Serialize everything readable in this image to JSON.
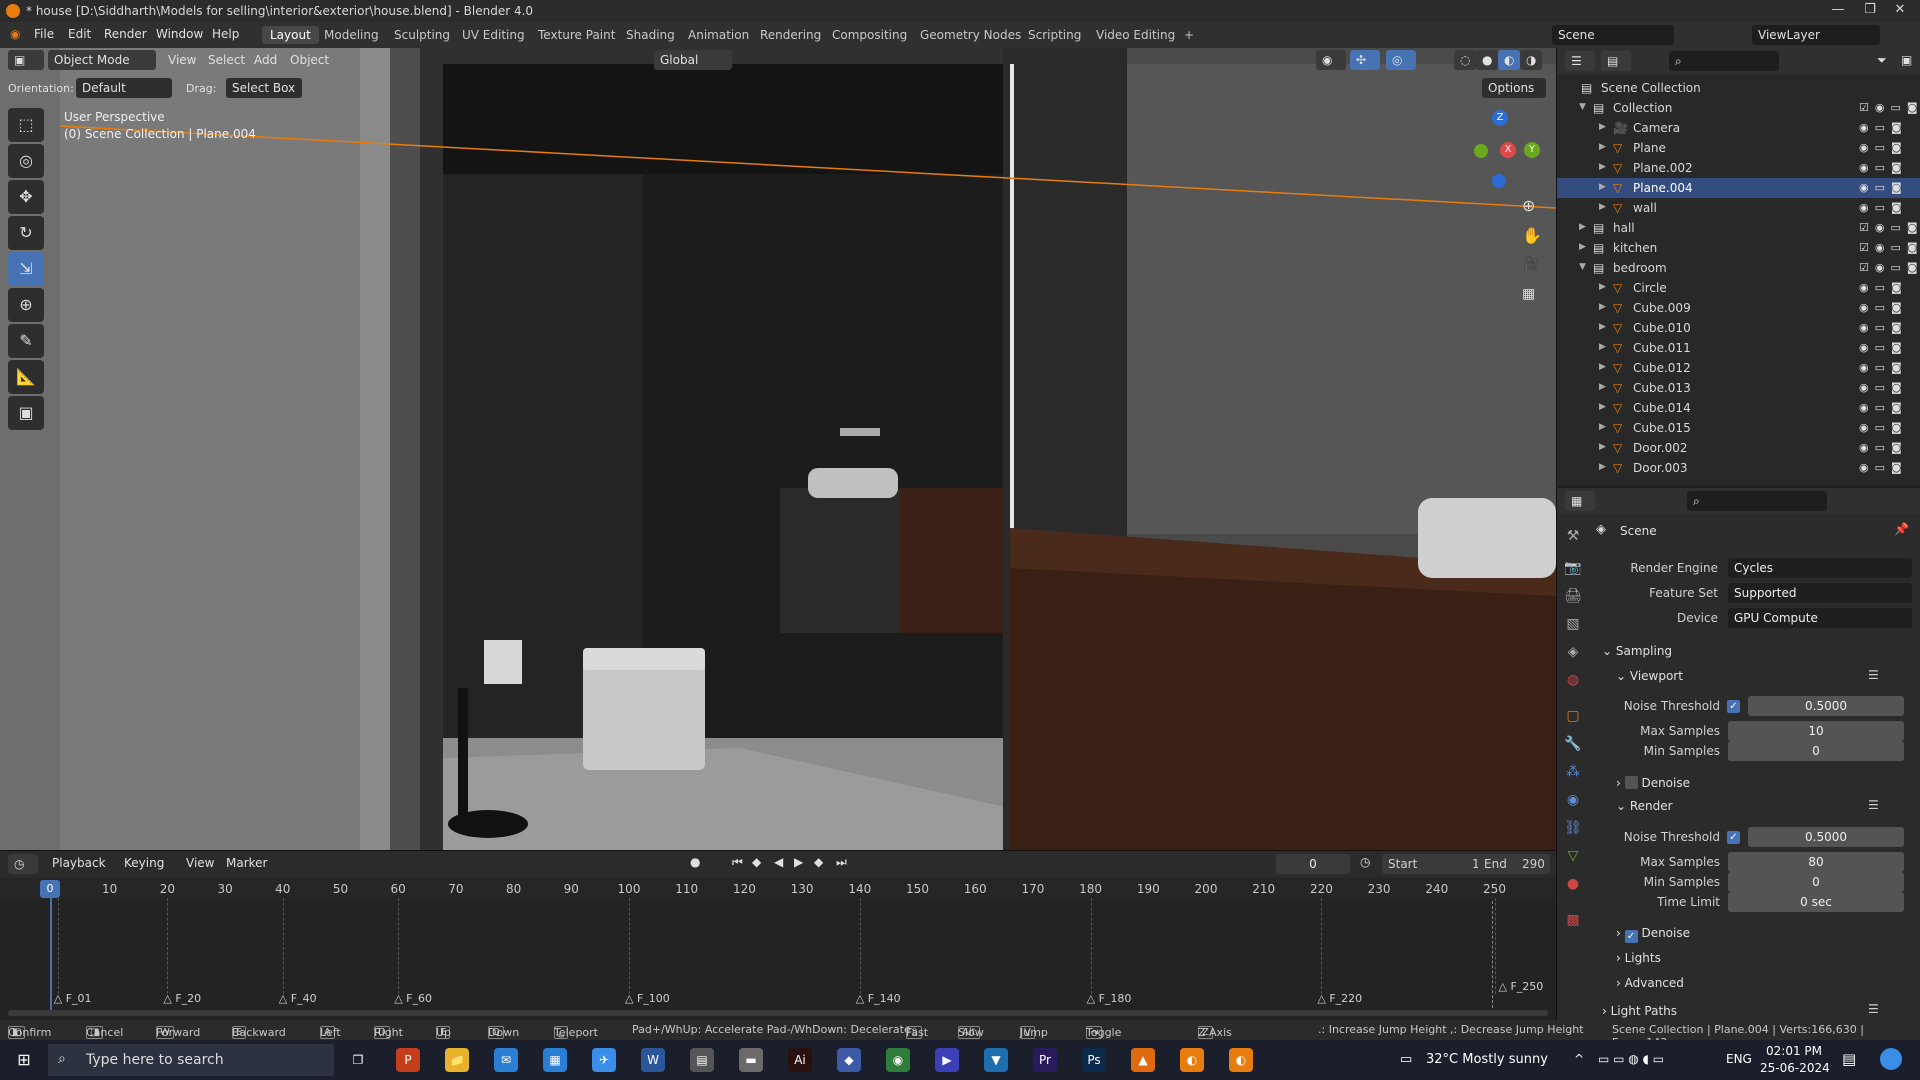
{
  "window": {
    "title": "* house [D:\\Siddharth\\Models for selling\\interior&exterior\\house.blend] - Blender 4.0",
    "minimize": "—",
    "maximize": "❐",
    "close": "✕"
  },
  "menu": [
    "File",
    "Edit",
    "Render",
    "Window",
    "Help"
  ],
  "workspaces": [
    "Layout",
    "Modeling",
    "Sculpting",
    "UV Editing",
    "Texture Paint",
    "Shading",
    "Animation",
    "Rendering",
    "Compositing",
    "Geometry Nodes",
    "Scripting",
    "Video Editing"
  ],
  "workspace_add": "+",
  "scene_field": "Scene",
  "viewlayer_field": "ViewLayer",
  "viewport_header": {
    "mode": "Object Mode",
    "menus": [
      "View",
      "Select",
      "Add",
      "Object"
    ],
    "transform": "Global",
    "options": "Options"
  },
  "tool_settings": {
    "orientation_label": "Orientation:",
    "orientation": "Default",
    "drag_label": "Drag:",
    "drag": "Select Box"
  },
  "viewport_info": {
    "perspective": "User Perspective",
    "collection": "(0) Scene Collection | Plane.004"
  },
  "gizmo": {
    "z": "Z",
    "x": "X",
    "y": "Y"
  },
  "tools": [
    "⬚",
    "◎",
    "✥",
    "↻",
    "⇲",
    "⊕",
    "✎",
    "📐",
    "▣"
  ],
  "outliner": {
    "root": "Scene Collection",
    "rows": [
      {
        "name": "Collection",
        "indent": 1,
        "type": "collection",
        "expanded": true
      },
      {
        "name": "Camera",
        "indent": 2,
        "type": "camera"
      },
      {
        "name": "Plane",
        "indent": 2,
        "type": "mesh"
      },
      {
        "name": "Plane.002",
        "indent": 2,
        "type": "mesh"
      },
      {
        "name": "Plane.004",
        "indent": 2,
        "type": "mesh",
        "selected": true
      },
      {
        "name": "wall",
        "indent": 2,
        "type": "mesh"
      },
      {
        "name": "hall",
        "indent": 1,
        "type": "collection"
      },
      {
        "name": "kitchen",
        "indent": 1,
        "type": "collection"
      },
      {
        "name": "bedroom",
        "indent": 1,
        "type": "collection",
        "expanded": true
      },
      {
        "name": "Circle",
        "indent": 2,
        "type": "mesh"
      },
      {
        "name": "Cube.009",
        "indent": 2,
        "type": "mesh"
      },
      {
        "name": "Cube.010",
        "indent": 2,
        "type": "mesh"
      },
      {
        "name": "Cube.011",
        "indent": 2,
        "type": "mesh"
      },
      {
        "name": "Cube.012",
        "indent": 2,
        "type": "mesh"
      },
      {
        "name": "Cube.013",
        "indent": 2,
        "type": "mesh"
      },
      {
        "name": "Cube.014",
        "indent": 2,
        "type": "mesh"
      },
      {
        "name": "Cube.015",
        "indent": 2,
        "type": "mesh"
      },
      {
        "name": "Door.002",
        "indent": 2,
        "type": "mesh"
      },
      {
        "name": "Door.003",
        "indent": 2,
        "type": "mesh"
      }
    ]
  },
  "properties": {
    "context": "Scene",
    "render_engine_label": "Render Engine",
    "render_engine": "Cycles",
    "feature_set_label": "Feature Set",
    "feature_set": "Supported",
    "device_label": "Device",
    "device": "GPU Compute",
    "sampling": "Sampling",
    "viewport": "Viewport",
    "noise_threshold_label": "Noise Threshold",
    "vp_noise": "0.5000",
    "max_samples_label": "Max Samples",
    "vp_max": "10",
    "min_samples_label": "Min Samples",
    "vp_min": "0",
    "denoise": "Denoise",
    "render": "Render",
    "r_noise": "0.5000",
    "r_max": "80",
    "r_min": "0",
    "time_limit_label": "Time Limit",
    "time_limit": "0 sec",
    "lights": "Lights",
    "advanced": "Advanced",
    "light_paths": "Light Paths"
  },
  "timeline": {
    "menus": [
      "Playback",
      "Keying",
      "View",
      "Marker"
    ],
    "current": "0",
    "start_label": "Start",
    "start": "1",
    "end_label": "End",
    "end": "290",
    "frames": [
      "0",
      "10",
      "20",
      "30",
      "40",
      "50",
      "60",
      "70",
      "80",
      "90",
      "100",
      "110",
      "120",
      "130",
      "140",
      "150",
      "160",
      "170",
      "180",
      "190",
      "200",
      "210",
      "220",
      "230",
      "240",
      "250"
    ],
    "markers": [
      "F_01",
      "F_20",
      "F_40",
      "F_60",
      "F_100",
      "F_140",
      "F_180",
      "F_220",
      "F_250"
    ]
  },
  "status": {
    "items": [
      {
        "key": "",
        "label": "Confirm"
      },
      {
        "key": "",
        "label": "Cancel"
      },
      {
        "key": "W",
        "label": "Forward"
      },
      {
        "key": "S",
        "label": "Backward"
      },
      {
        "key": "A",
        "label": "Left"
      },
      {
        "key": "D",
        "label": "Right"
      },
      {
        "key": "E",
        "label": "Up"
      },
      {
        "key": "Q",
        "label": "Down"
      },
      {
        "key": "",
        "label": "Teleport"
      }
    ],
    "hint1": "Pad+/WhUp: Accelerate  Pad-/WhDown: Decelerate",
    "fast": "Fast",
    "slow": "Slow",
    "jump": "Jump",
    "gravity": "Toggle Gravity",
    "zaxis": "Z Axis Correction",
    "jumpheight": ".: Increase Jump Height  ,: Decrease Jump Height",
    "stats": "Scene Collection | Plane.004 | Verts:166,630 | Faces:143,"
  },
  "taskbar": {
    "search_placeholder": "Type here to search",
    "weather": "32°C  Mostly sunny",
    "lang": "ENG",
    "time": "02:01 PM",
    "date": "25-06-2024",
    "apps": [
      "P",
      "📁",
      "✉",
      "▦",
      "✈",
      "W",
      "▤",
      "▬",
      "Ai",
      "◆",
      "◉",
      "▶",
      "▼",
      "Pr",
      "Ps",
      "▲",
      "◐",
      "◐"
    ]
  }
}
